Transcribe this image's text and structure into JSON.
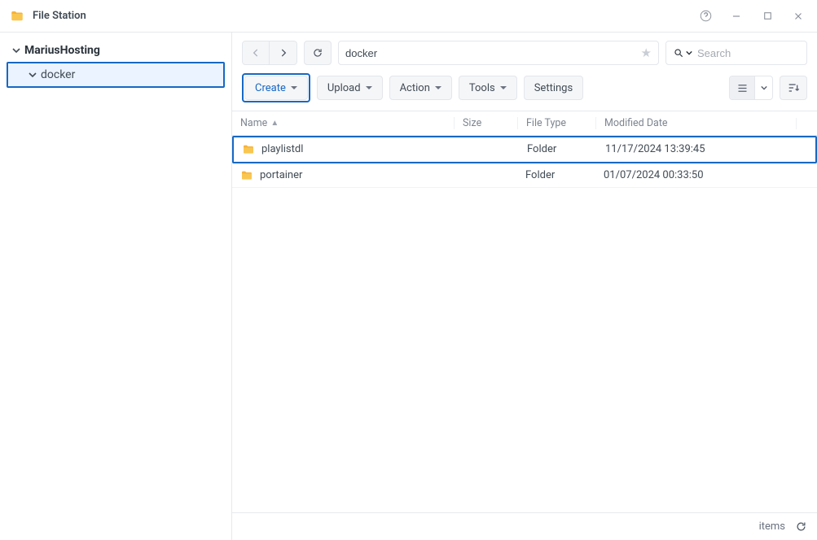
{
  "app": {
    "title": "File Station"
  },
  "sidebar": {
    "root": {
      "label": "MariusHosting",
      "expanded": true
    },
    "items": [
      {
        "label": "docker",
        "expanded": true,
        "selected": true,
        "highlighted": true
      }
    ]
  },
  "nav": {
    "path_value": "docker",
    "search_placeholder": "Search"
  },
  "toolbar": {
    "create_label": "Create",
    "upload_label": "Upload",
    "action_label": "Action",
    "tools_label": "Tools",
    "settings_label": "Settings"
  },
  "table": {
    "columns": {
      "name": "Name",
      "size": "Size",
      "type": "File Type",
      "modified": "Modified Date"
    },
    "sort_column": "name",
    "sort_dir": "asc",
    "rows": [
      {
        "name": "playlistdl",
        "size": "",
        "type": "Folder",
        "modified": "11/17/2024 13:39:45",
        "highlighted": true
      },
      {
        "name": "portainer",
        "size": "",
        "type": "Folder",
        "modified": "01/07/2024 00:33:50",
        "highlighted": false
      }
    ]
  },
  "status": {
    "items_label": "items"
  }
}
